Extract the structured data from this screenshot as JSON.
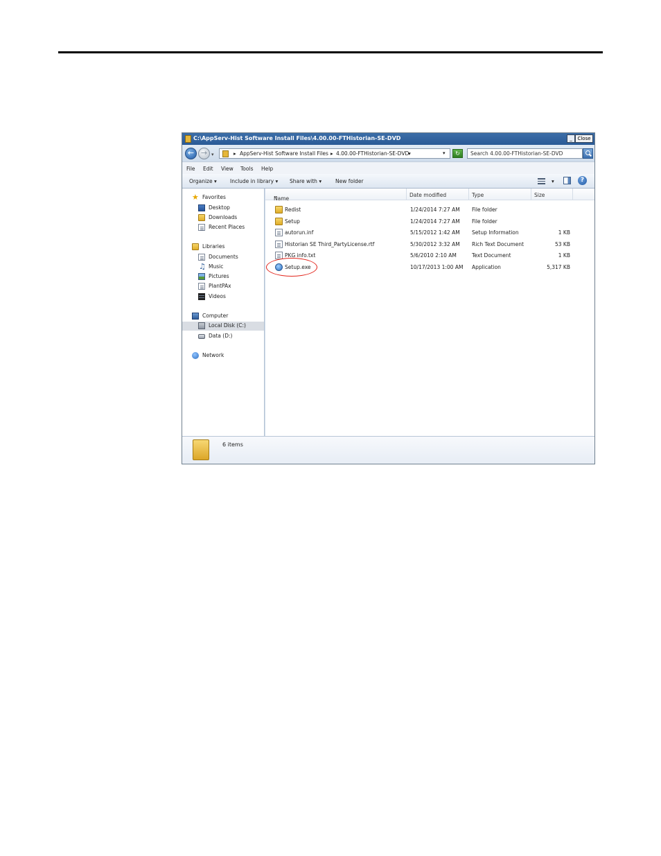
{
  "window": {
    "title": "C:\\AppServ-Hist Software Install Files\\4.00.00-FTHistorian-SE-DVD",
    "close_label": "Close",
    "minimize_label": "_"
  },
  "address": {
    "crumb1": "AppServ-Hist Software Install Files",
    "crumb2": "4.00.00-FTHistorian-SE-DVD",
    "sep": "▸"
  },
  "search": {
    "placeholder": "Search 4.00.00-FTHistorian-SE-DVD"
  },
  "menu": {
    "file": "File",
    "edit": "Edit",
    "view": "View",
    "tools": "Tools",
    "help": "Help"
  },
  "toolbar": {
    "organize": "Organize",
    "include_in_library": "Include in library",
    "share_with": "Share with",
    "new_folder": "New folder"
  },
  "nav": {
    "favorites": "Favorites",
    "desktop": "Desktop",
    "downloads": "Downloads",
    "recent_places": "Recent Places",
    "libraries": "Libraries",
    "documents": "Documents",
    "music": "Music",
    "pictures": "Pictures",
    "plantpax": "PlantPAx",
    "videos": "Videos",
    "computer": "Computer",
    "local_disk": "Local Disk (C:)",
    "data_disk": "Data (D:)",
    "network": "Network"
  },
  "columns": {
    "name": "Name",
    "date_modified": "Date modified",
    "type": "Type",
    "size": "Size"
  },
  "files": [
    {
      "name": "Redist",
      "date": "1/24/2014 7:27 AM",
      "type": "File folder",
      "size": ""
    },
    {
      "name": "Setup",
      "date": "1/24/2014 7:27 AM",
      "type": "File folder",
      "size": ""
    },
    {
      "name": "autorun.inf",
      "date": "5/15/2012 1:42 AM",
      "type": "Setup Information",
      "size": "1 KB"
    },
    {
      "name": "Historian SE Third_PartyLicense.rtf",
      "date": "5/30/2012 3:32 AM",
      "type": "Rich Text Document",
      "size": "53 KB"
    },
    {
      "name": "PKG info.txt",
      "date": "5/6/2010 2:10 AM",
      "type": "Text Document",
      "size": "1 KB"
    },
    {
      "name": "Setup.exe",
      "date": "10/17/2013 1:00 AM",
      "type": "Application",
      "size": "5,317 KB"
    }
  ],
  "status": {
    "item_count": "6 items"
  },
  "colors": {
    "highlight_circle": "#e2231a",
    "title_bar": "#2a5a96"
  }
}
